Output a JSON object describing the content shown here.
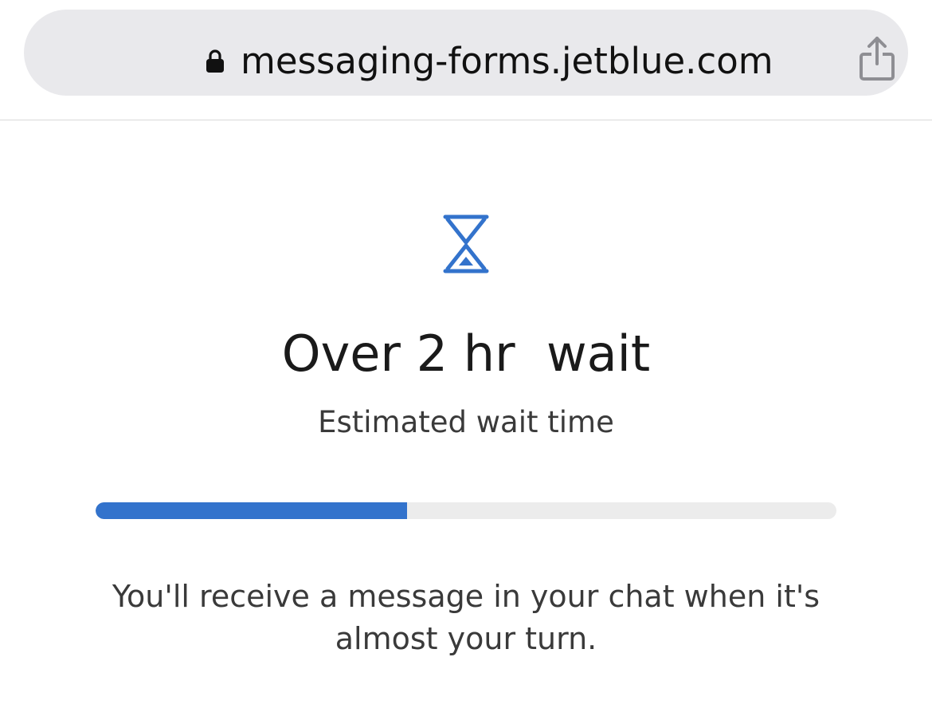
{
  "browser": {
    "url": "messaging-forms.jetblue.com",
    "lock_icon": "lock-icon",
    "share_icon": "share-icon"
  },
  "main": {
    "icon": "hourglass-icon",
    "title": "Over 2 hr  wait",
    "subtitle": "Estimated wait time",
    "progress_fraction": 0.42,
    "message": "You'll receive a message in your chat when it's almost your turn."
  },
  "colors": {
    "accent": "#3373cc",
    "track": "#ececec",
    "url_pill": "#e9e9ec"
  }
}
